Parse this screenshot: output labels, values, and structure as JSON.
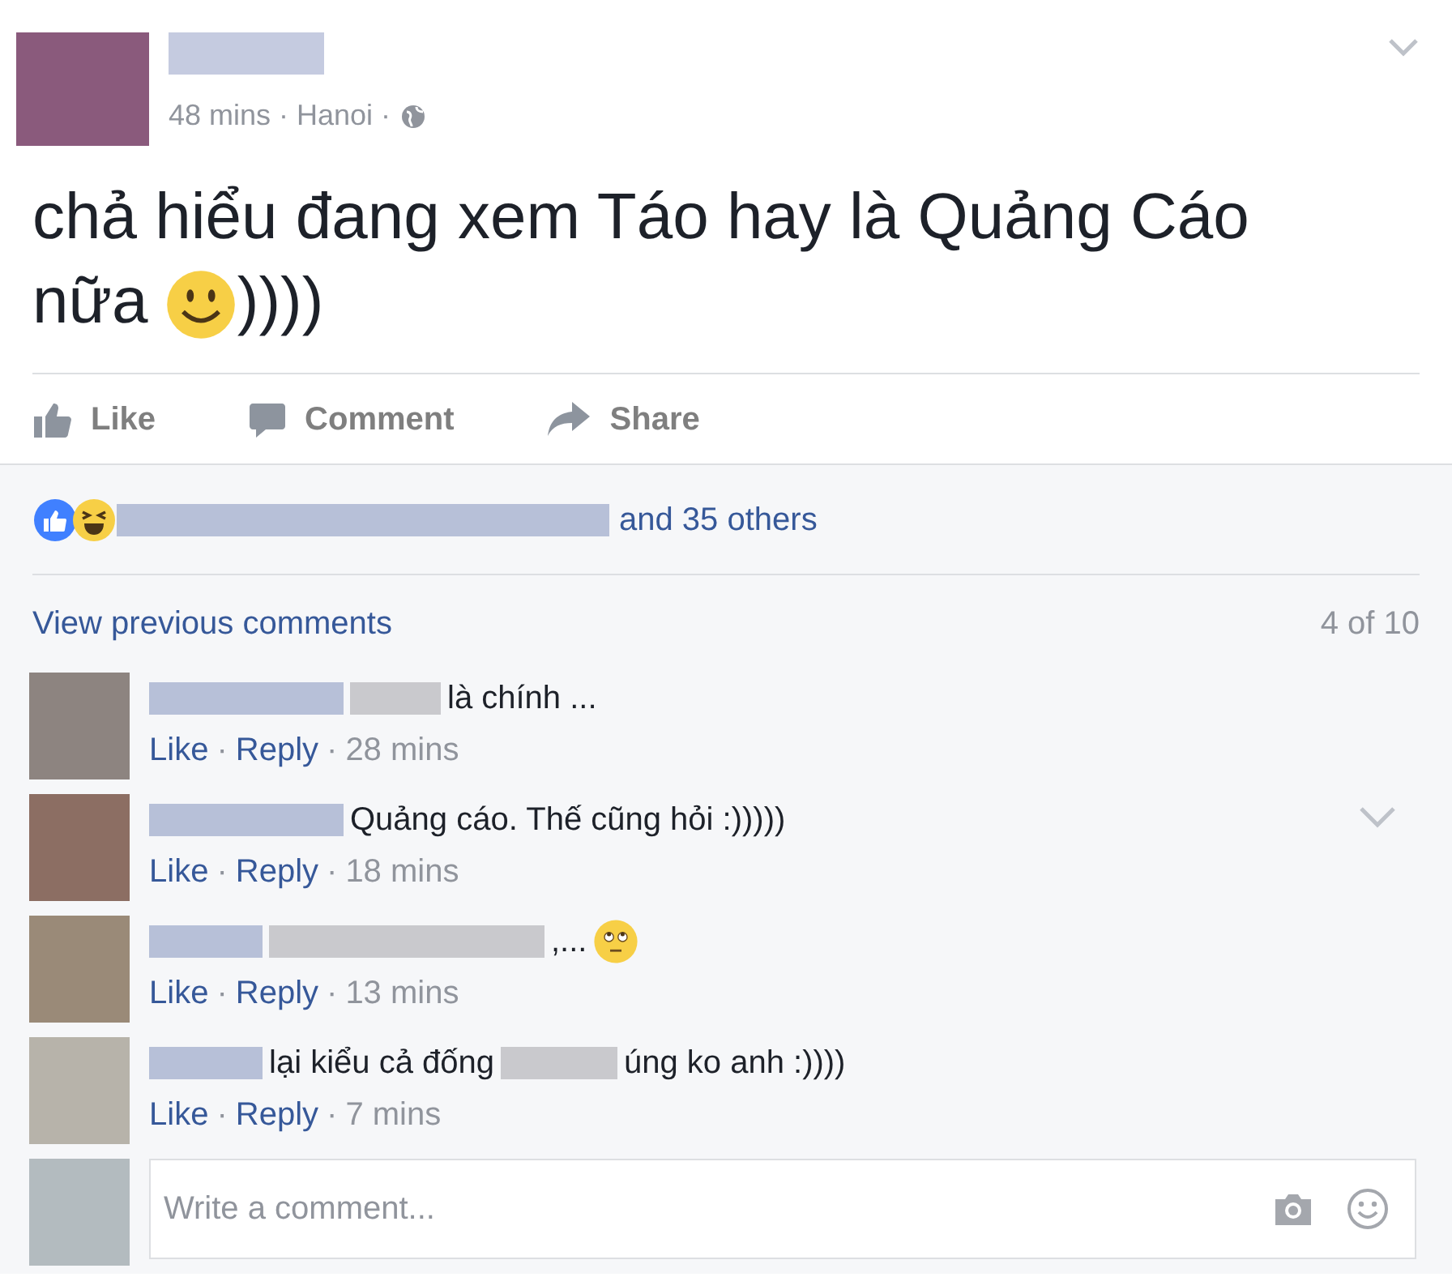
{
  "post": {
    "meta": "48 mins · Hanoi ·",
    "text_before": "chả hiểu đang xem Táo hay là Quảng Cáo nữa",
    "text_after": "))))"
  },
  "actions": [
    {
      "kind": "like",
      "label": "Like"
    },
    {
      "kind": "comment",
      "label": "Comment"
    },
    {
      "kind": "share",
      "label": "Share"
    }
  ],
  "reactions": {
    "summary": "and 35 others"
  },
  "comments_header": {
    "link": "View previous comments",
    "count": "4 of 10"
  },
  "comments": [
    {
      "menu": false,
      "segments": [
        {
          "kind": "redacted"
        },
        {
          "kind": "redacted_grey"
        },
        {
          "kind": "text",
          "text": "là chính ..."
        }
      ],
      "footer": [
        {
          "kind": "link",
          "text": "Like"
        },
        {
          "kind": "sep",
          "text": "·"
        },
        {
          "kind": "link",
          "text": "Reply"
        },
        {
          "kind": "sep",
          "text": "·"
        },
        {
          "kind": "time",
          "text": "28 mins"
        }
      ]
    },
    {
      "menu": true,
      "segments": [
        {
          "kind": "redacted"
        },
        {
          "kind": "text",
          "text": "Quảng cáo. Thế cũng hỏi :)))))"
        }
      ],
      "footer": [
        {
          "kind": "link",
          "text": "Like"
        },
        {
          "kind": "sep",
          "text": "·"
        },
        {
          "kind": "link",
          "text": "Reply"
        },
        {
          "kind": "sep",
          "text": "·"
        },
        {
          "kind": "time",
          "text": "18 mins"
        }
      ]
    },
    {
      "menu": false,
      "segments": [
        {
          "kind": "redacted"
        },
        {
          "kind": "redacted_grey"
        },
        {
          "kind": "text",
          "text": ",..."
        },
        {
          "kind": "emoji"
        }
      ],
      "footer": [
        {
          "kind": "link",
          "text": "Like"
        },
        {
          "kind": "sep",
          "text": "·"
        },
        {
          "kind": "link",
          "text": "Reply"
        },
        {
          "kind": "sep",
          "text": "·"
        },
        {
          "kind": "time",
          "text": "13 mins"
        }
      ]
    },
    {
      "menu": false,
      "segments": [
        {
          "kind": "redacted"
        },
        {
          "kind": "text",
          "text": "lại kiểu cả đống"
        },
        {
          "kind": "redacted_grey"
        },
        {
          "kind": "text",
          "text": "úng ko anh :))))"
        }
      ],
      "footer": [
        {
          "kind": "link",
          "text": "Like"
        },
        {
          "kind": "sep",
          "text": "·"
        },
        {
          "kind": "link",
          "text": "Reply"
        },
        {
          "kind": "sep",
          "text": "·"
        },
        {
          "kind": "time",
          "text": "7 mins"
        }
      ]
    }
  ],
  "composer": {
    "placeholder": "Write a comment..."
  }
}
